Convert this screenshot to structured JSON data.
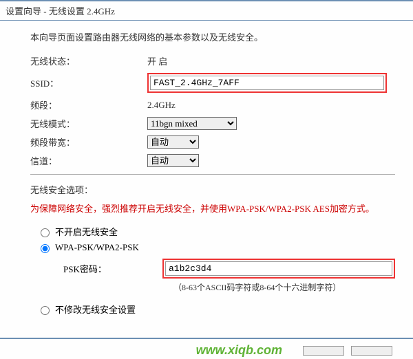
{
  "title": "设置向导 - 无线设置 2.4GHz",
  "intro": "本向导页面设置路由器无线网络的基本参数以及无线安全。",
  "fields": {
    "status_label": "无线状态：",
    "status_value": "开 启",
    "ssid_label": "SSID：",
    "ssid_value": "FAST_2.4GHz_7AFF",
    "band_label": "频段：",
    "band_value": "2.4GHz",
    "mode_label": "无线模式：",
    "mode_value": "11bgn mixed",
    "bandwidth_label": "频段带宽：",
    "bandwidth_value": "自动",
    "channel_label": "信道：",
    "channel_value": "自动"
  },
  "security": {
    "heading": "无线安全选项：",
    "warning": "为保障网络安全，强烈推荐开启无线安全，并使用WPA-PSK/WPA2-PSK AES加密方式。",
    "opt_none": "不开启无线安全",
    "opt_wpa": "WPA-PSK/WPA2-PSK",
    "psk_label": "PSK密码：",
    "psk_value": "a1b2c3d4",
    "psk_hint": "（8-63个ASCII码字符或8-64个十六进制字符）",
    "opt_keep": "不修改无线安全设置"
  },
  "watermark": "www.xiqb.com"
}
